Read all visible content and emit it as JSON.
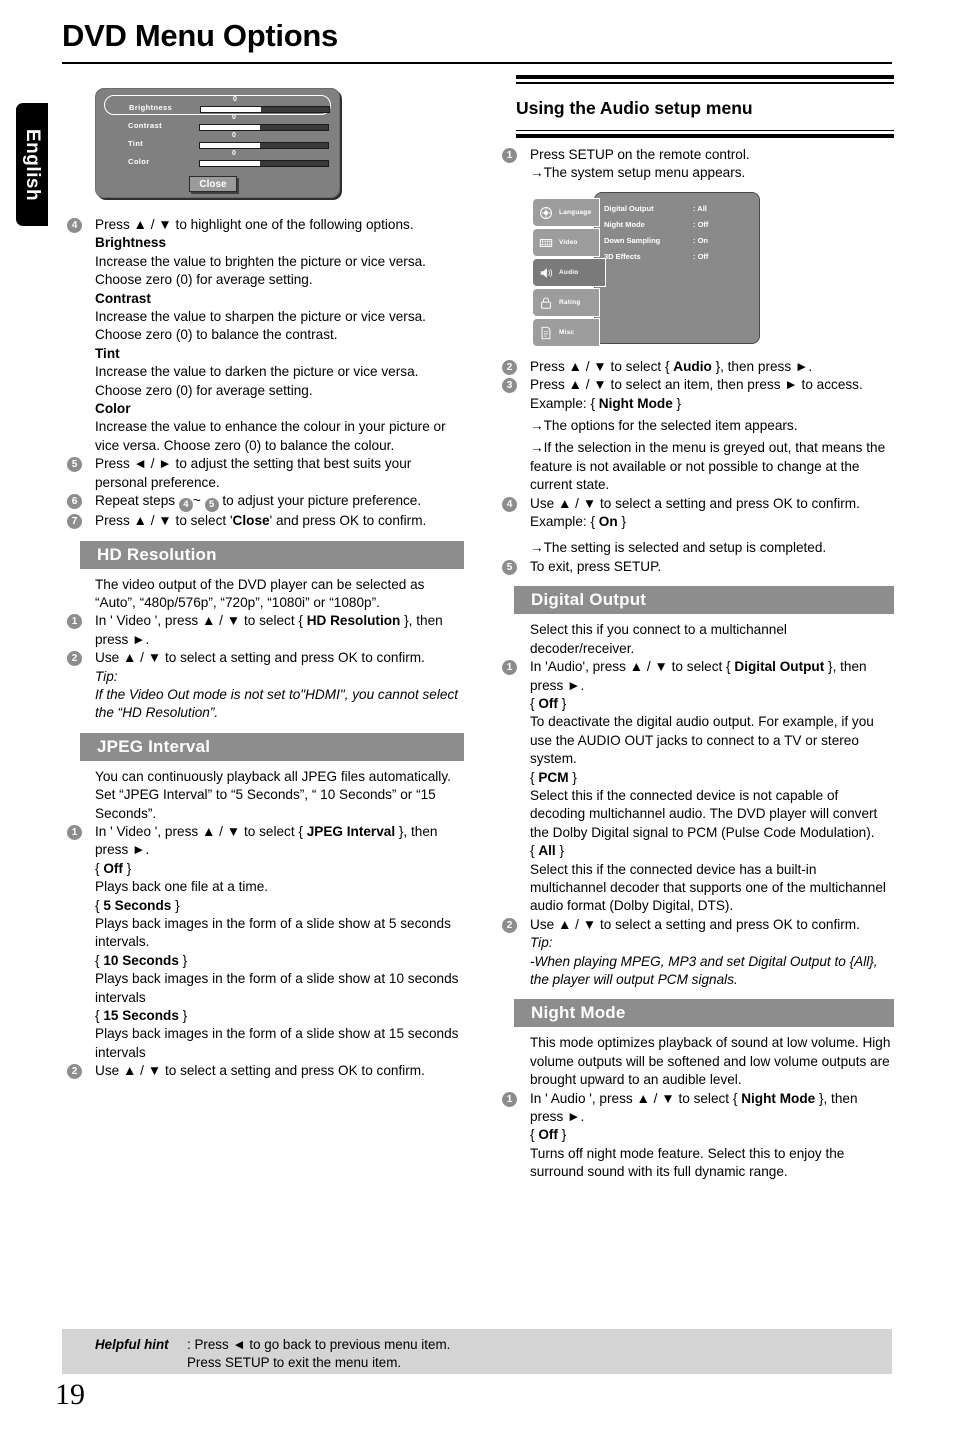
{
  "page": {
    "title": "DVD Menu Options",
    "language_tab": "English",
    "page_number": "19"
  },
  "picture_osd": {
    "rows": [
      {
        "label": "Brightness",
        "value": "0",
        "highlighted": true
      },
      {
        "label": "Contrast",
        "value": "0",
        "highlighted": false
      },
      {
        "label": "Tint",
        "value": "0",
        "highlighted": false
      },
      {
        "label": "Color",
        "value": "0",
        "highlighted": false
      }
    ],
    "close_button": "Close"
  },
  "left_column": {
    "step4": {
      "num": "4",
      "text": "Press ▲ / ▼ to highlight one of the following options."
    },
    "options": [
      {
        "name": "Brightness",
        "desc": "Increase the value to brighten the picture or vice versa. Choose zero (0) for average setting."
      },
      {
        "name": "Contrast",
        "desc": "Increase the value to sharpen the picture or vice versa.  Choose zero (0) to balance the contrast."
      },
      {
        "name": "Tint",
        "desc": "Increase the value to darken the picture or vice versa.  Choose zero (0) for average setting."
      },
      {
        "name": "Color",
        "desc": "Increase the value to enhance the colour in your picture or vice versa. Choose zero (0) to balance the colour."
      }
    ],
    "step5": {
      "num": "5",
      "text": "Press ◄ / ► to adjust the setting that best suits your personal preference."
    },
    "step6": {
      "num": "6",
      "pre": "Repeat steps",
      "a": "4",
      "mid": "~",
      "b": "5",
      "post": "to adjust your picture preference."
    },
    "step7": {
      "num": "7",
      "pre": "Press ▲ / ▼ to select  '",
      "bold": "Close",
      "post": "'  and press OK to confirm."
    },
    "hd_resolution": {
      "heading": "HD Resolution",
      "intro": "The video output of the DVD player can be selected as “Auto”, “480p/576p”, “720p”, “1080i” or “1080p”.",
      "step1_num": "1",
      "step1_pre": "In ' Video ', press ▲ / ▼ to select  {",
      "step1_bold": "HD Resolution",
      "step1_post": "}, then press ►.",
      "step2_num": "2",
      "step2_text": "Use ▲ / ▼ to select a setting and press OK to confirm.",
      "tip_label": "Tip:",
      "tip_text": "If the Video Out mode is not set to\"HDMI\", you cannot select the “HD Resolution”."
    },
    "jpeg_interval": {
      "heading": "JPEG Interval",
      "intro": "You can continuously playback all JPEG files automatically. Set “JPEG Interval” to “5 Seconds”, “ 10 Seconds” or “15 Seconds”.",
      "step1_num": "1",
      "step1_pre": "In ' Video ', press ▲ / ▼ to select  {",
      "step1_bold": "JPEG Interval",
      "step1_post": "}, then press  ►.",
      "settings": [
        {
          "name": "Off",
          "desc": "Plays back one file at a time."
        },
        {
          "name": "5 Seconds",
          "desc": "Plays back images in the form of a slide show at 5 seconds intervals."
        },
        {
          "name": "10 Seconds",
          "desc": "Plays back images in the form of a slide show at 10 seconds intervals"
        },
        {
          "name": "15 Seconds",
          "desc": "Plays back images in the form of a slide show at 15 seconds intervals"
        }
      ],
      "step2_num": "2",
      "step2_text": "Use ▲ / ▼ to select a setting and press OK to confirm."
    }
  },
  "right_column": {
    "heading": "Using the Audio setup menu",
    "step1": {
      "num": "1",
      "text": "Press SETUP on the remote control.",
      "arrow": "→The system setup menu appears."
    },
    "setup_osd": {
      "tabs": [
        {
          "label": "Language",
          "icon": "globe-icon",
          "active": false
        },
        {
          "label": "Video",
          "icon": "film-icon",
          "active": false
        },
        {
          "label": "Audio",
          "icon": "speaker-icon",
          "active": true
        },
        {
          "label": "Rating",
          "icon": "lock-icon",
          "active": false
        },
        {
          "label": "Misc",
          "icon": "document-icon",
          "active": false
        }
      ],
      "items": [
        {
          "key": "Digital Output",
          "value": ": All"
        },
        {
          "key": "Night  Mode",
          "value": ": Off"
        },
        {
          "key": "Down Sampling",
          "value": ": On"
        },
        {
          "key": "3D Effects",
          "value": ": Off"
        }
      ]
    },
    "step2": {
      "num": "2",
      "pre": "Press ▲ / ▼ to select {",
      "bold": "Audio",
      "post": "}, then press ►."
    },
    "step3": {
      "num": "3",
      "text": "Press ▲ / ▼ to select an item, then press ► to access.",
      "example_pre": "Example: {",
      "example_bold": "Night Mode",
      "example_post": "}",
      "arrow1": "→The options for the selected item appears.",
      "arrow2": "→If the selection in the menu is greyed out, that means the feature is not available or not possible to change at the current state."
    },
    "step4": {
      "num": "4",
      "text": "Use ▲ / ▼ to select a setting and press OK to confirm.",
      "example_pre": "Example: {",
      "example_bold": "On",
      "example_post": "}",
      "arrow": "→The setting is selected and setup is completed."
    },
    "step5": {
      "num": "5",
      "text": "To exit, press SETUP."
    },
    "digital_output": {
      "heading": "Digital Output",
      "intro": "Select this if you connect to a multichannel decoder/receiver.",
      "step1_num": "1",
      "step1_pre": "In 'Audio', press ▲ / ▼ to select {",
      "step1_bold": "Digital Output",
      "step1_post": "}, then press ►.",
      "settings": [
        {
          "name": "Off",
          "desc": "To deactivate the digital audio output. For example, if you use the AUDIO OUT jacks to connect to a TV or stereo system."
        },
        {
          "name": "PCM",
          "desc": "Select this if the connected device is not capable of decoding multichannel audio. The DVD player will convert the Dolby Digital signal to PCM (Pulse Code Modulation)."
        },
        {
          "name": "All",
          "desc": "Select this if the connected device has a built-in multichannel decoder that supports one of the multichannel audio format (Dolby Digital, DTS)."
        }
      ],
      "step2_num": "2",
      "step2_text": "Use ▲ / ▼ to select a setting  and press OK to confirm.",
      "tip_label": "Tip:",
      "tip_text": "-When playing MPEG, MP3 and set Digital Output to {All}, the player will output PCM signals."
    },
    "night_mode": {
      "heading": "Night Mode",
      "intro": "This mode optimizes playback of sound at low volume. High volume outputs will be softened and low volume outputs are brought upward to an audible level.",
      "step1_num": "1",
      "step1_pre": "In  '  Audio  ', press ▲ / ▼ to select {",
      "step1_bold": "Night Mode",
      "step1_post": "}, then press ►.",
      "settings": [
        {
          "name": "Off",
          "desc": "Turns off night mode feature. Select this to enjoy the surround sound with its full dynamic range."
        }
      ]
    }
  },
  "footer": {
    "label": "Helpful hint",
    "line1": ": Press ◄ to go back to previous menu item.",
    "line2": "Press SETUP to exit the menu item."
  }
}
